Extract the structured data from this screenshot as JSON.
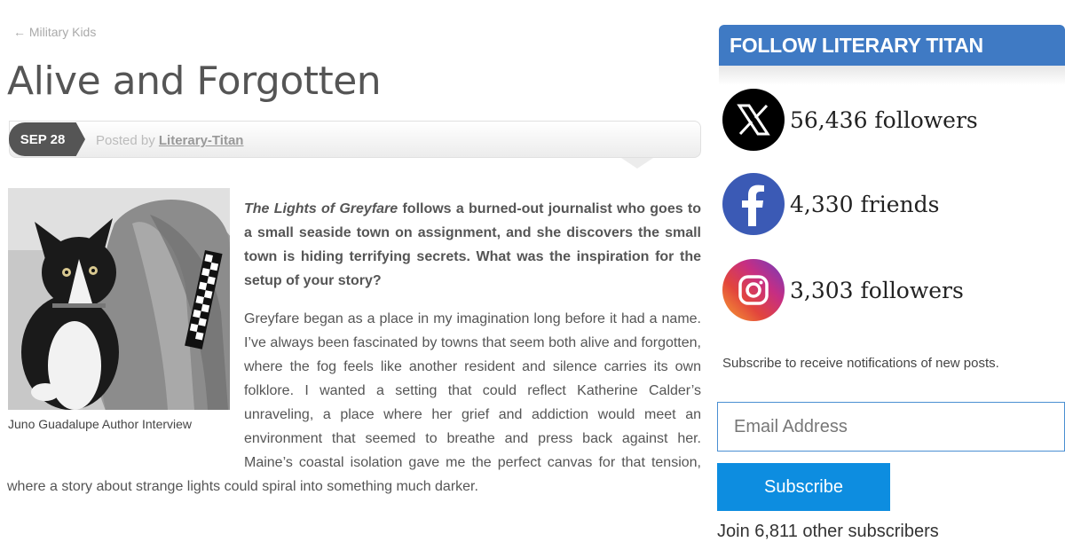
{
  "nav": {
    "back_link": "← Military Kids"
  },
  "post": {
    "title": "Alive and Forgotten",
    "date": "SEP 28",
    "posted_by_prefix": "Posted by ",
    "author": "Literary-Titan",
    "image_caption": "Juno Guadalupe Author Interview",
    "question_title": "The Lights of Greyfare",
    "question_rest": " follows a burned-out journalist who goes to a small seaside town on assignment, and she discovers the small town is hiding terrifying secrets. What was the inspiration for the setup of your story?",
    "answer": "Greyfare began as a place in my imagination long before it had a name. I’ve always been fascinated by towns that seem both alive and forgotten, where the fog feels like another resident and silence carries its own folklore. I wanted a setting that could reflect Katherine Calder’s unraveling, a place where her grief and addiction would meet an environment that seemed to breathe and press back against her. Maine’s coastal isolation gave me the perfect canvas for that tension, where a story about strange lights could spiral into something much darker."
  },
  "sidebar": {
    "follow_title": "FOLLOW LITERARY TITAN",
    "socials": [
      {
        "icon": "x-icon",
        "count": "56,436 followers",
        "color": "#000000"
      },
      {
        "icon": "facebook-icon",
        "count": "4,330 friends",
        "color": "#3b5ab5"
      },
      {
        "icon": "instagram-icon",
        "count": "3,303 followers",
        "color": "#c62e83"
      }
    ],
    "subscribe_text": "Subscribe to receive notifications of new posts.",
    "email_placeholder": "Email Address",
    "subscribe_label": "Subscribe",
    "join_text": "Join 6,811 other subscribers"
  },
  "colors": {
    "accent": "#3f7ac4",
    "button": "#0d8de0",
    "badge": "#555555"
  }
}
